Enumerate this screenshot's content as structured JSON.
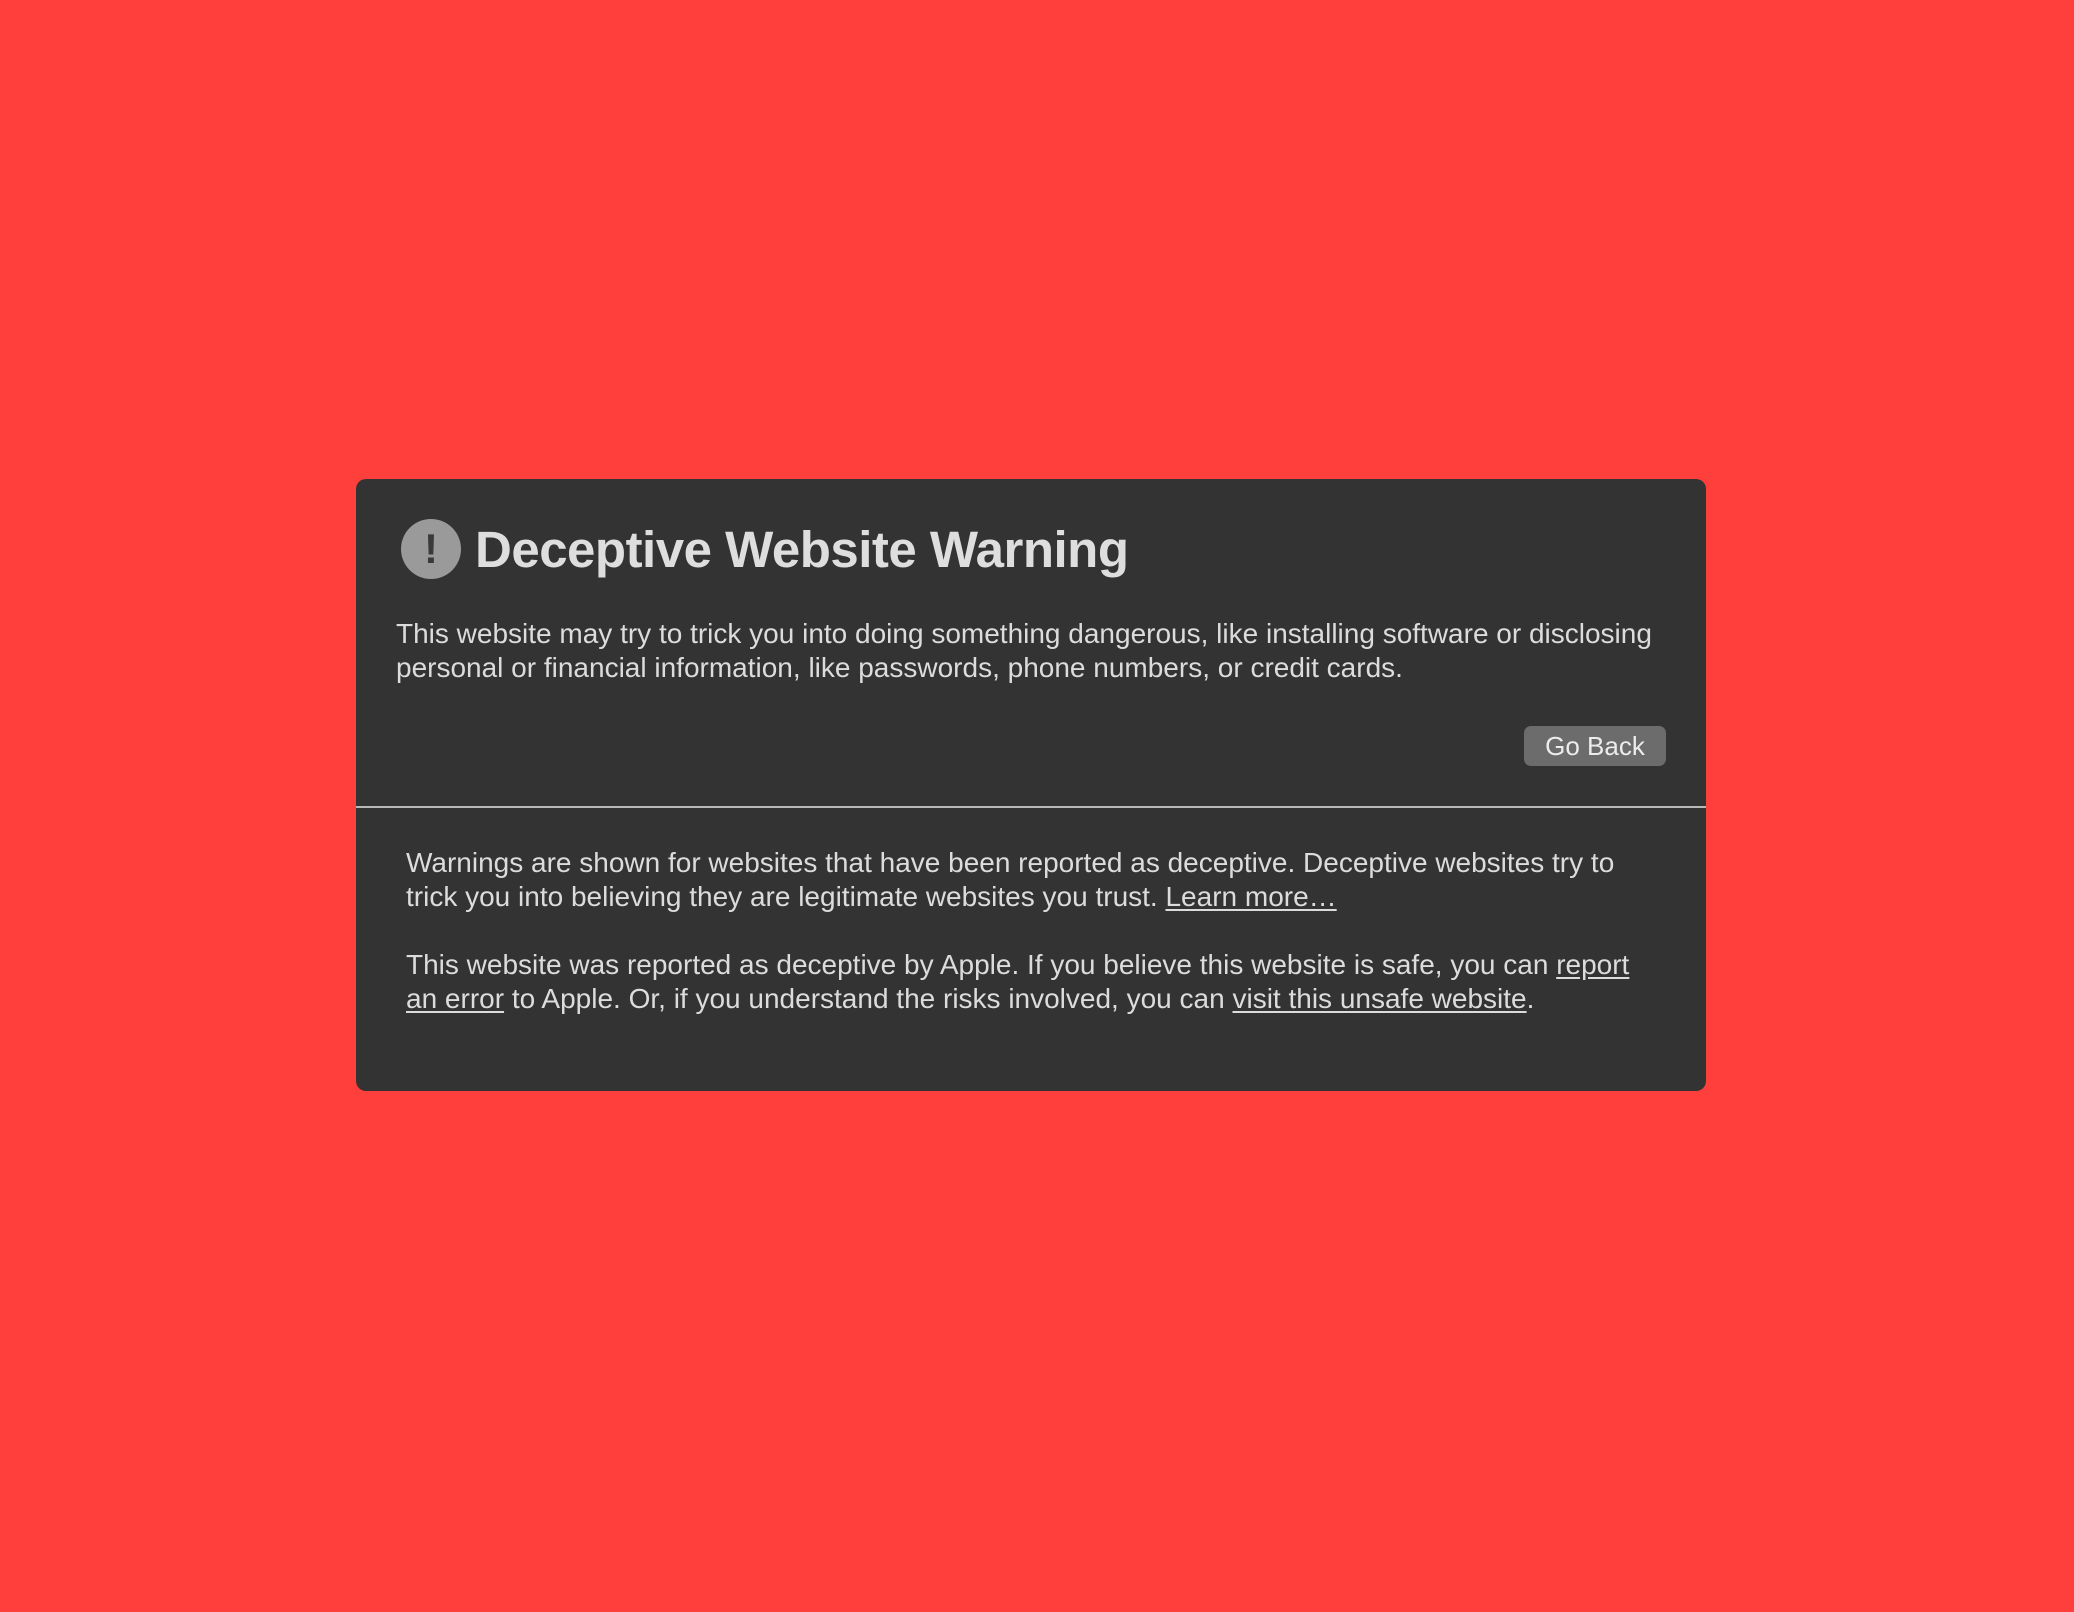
{
  "warning": {
    "icon_symbol": "!",
    "icon_name": "exclamation-circle-icon",
    "title": "Deceptive Website Warning",
    "intro_text": "This website may try to trick you into doing something dangerous, like installing software or disclosing personal or financial information, like passwords, phone numbers, or credit cards.",
    "go_back_label": "Go Back"
  },
  "details": {
    "paragraph1_text": "Warnings are shown for websites that have been reported as deceptive. Deceptive websites try to trick you into believing they are legitimate websites you trust. ",
    "learn_more_link": "Learn more…",
    "paragraph2_part1": "This website was reported as deceptive by Apple. If you believe this website is safe, you can ",
    "report_error_link": "report an error",
    "paragraph2_part2": " to Apple. Or, if you understand the risks involved, you can ",
    "visit_unsafe_link": "visit this unsafe website",
    "paragraph2_end": "."
  },
  "colors": {
    "background": "#ff3f3c",
    "panel": "#333333",
    "text": "#dcdcdc",
    "button": "#6c6c6c"
  }
}
